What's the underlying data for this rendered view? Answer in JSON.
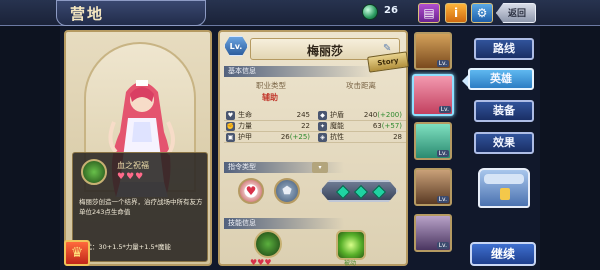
{
  "header": {
    "title": "营地",
    "gem_count": "26",
    "back_label": "返回",
    "icons": [
      "book-icon",
      "info-icon",
      "gear-icon"
    ],
    "info_glyph": "i"
  },
  "hero": {
    "level_badge": "Lv.",
    "name": "梅丽莎",
    "story_label": "Story",
    "section_basic": "基本信息",
    "type_label_left": "职业类型",
    "type_value_left": "辅助",
    "type_label_right": "攻击距离",
    "type_value_right": "",
    "stats": [
      {
        "icon": "heart-icon",
        "label": "生命",
        "value": "245",
        "bonus": ""
      },
      {
        "icon": "shield-icon",
        "label": "护盾",
        "value": "240",
        "bonus": "(+200)"
      },
      {
        "icon": "fist-icon",
        "label": "力量",
        "value": "22",
        "bonus": ""
      },
      {
        "icon": "magic-icon",
        "label": "魔能",
        "value": "63",
        "bonus": "(+57)"
      },
      {
        "icon": "armor-icon",
        "label": "护甲",
        "value": "26",
        "bonus": "(+25)"
      },
      {
        "icon": "resist-icon",
        "label": "抗性",
        "value": "28",
        "bonus": ""
      }
    ],
    "section_command": "指令类型",
    "section_skill": "技能信息"
  },
  "skill_card": {
    "name": "血之祝福",
    "hearts": "♥♥♥",
    "description": "梅丽莎创造一个结界，治疗战场中所有友方单位243点生命值",
    "formula": "公式：30+1.5*力量+1.5*魔能"
  },
  "skill_slots": {
    "slot1_hearts": "♥♥♥",
    "slot2_label": "被动"
  },
  "menu": {
    "items": [
      "路线",
      "英雄",
      "装备",
      "效果"
    ],
    "active_index": 1,
    "continue_label": "继续"
  },
  "portraits": [
    "Lv.",
    "Lv.",
    "Lv.",
    "Lv.",
    "Lv."
  ],
  "colors": {
    "accent": "#2b7dc4",
    "panel": "#e7dcc0",
    "bonus_green": "#2e8a2e",
    "type_red": "#c23a2e"
  }
}
